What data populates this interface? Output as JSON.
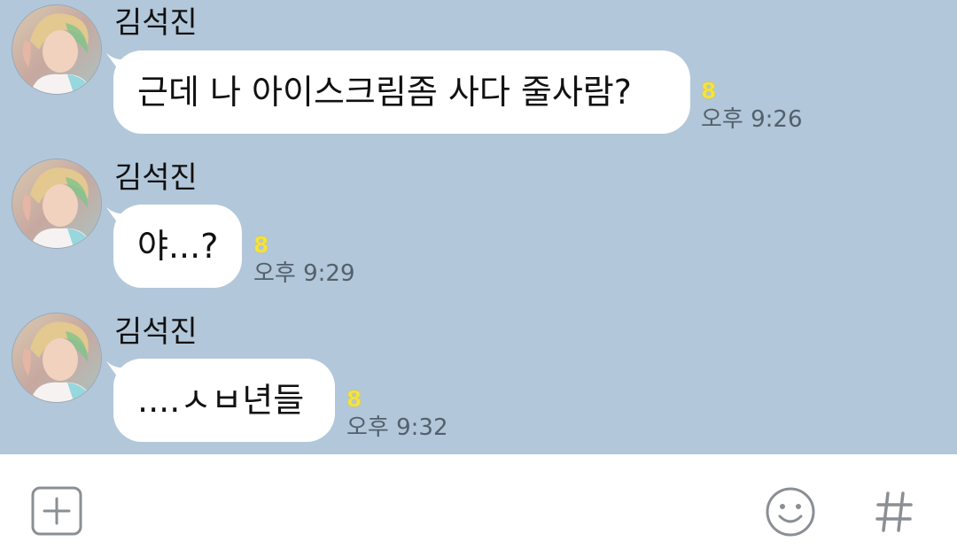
{
  "messages": [
    {
      "sender": "김석진",
      "text": "근데 나 아이스크림좀 사다 줄사람?",
      "unread": "8",
      "time": "오후 9:26"
    },
    {
      "sender": "김석진",
      "text": "야...?",
      "unread": "8",
      "time": "오후 9:29"
    },
    {
      "sender": "김석진",
      "text": "....ㅅㅂ년들",
      "unread": "8",
      "time": "오후 9:32"
    }
  ],
  "input_bar": {
    "icons": [
      "plus-icon",
      "emoji-icon",
      "hash-icon"
    ]
  },
  "colors": {
    "chat_background": "#b2c7da",
    "bubble": "#ffffff",
    "unread_badge": "#f5e340",
    "time_text": "#53606b",
    "icon_gray": "#8a8f94"
  }
}
